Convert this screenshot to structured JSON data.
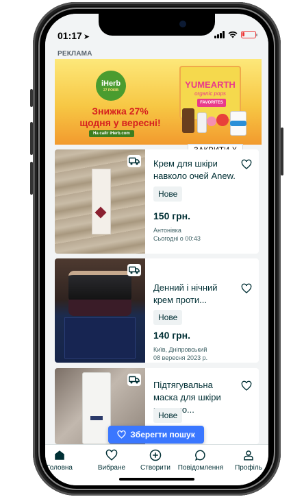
{
  "status_bar": {
    "time": "01:17"
  },
  "ad": {
    "label": "РЕКЛАМА",
    "brand": "iHerb",
    "brand_sub": "27 РОКІВ",
    "headline_line1": "Знижка 27%",
    "headline_line2": "щодня у вересні!",
    "cta": "На сайт iHerb.com",
    "product_brand": "YUMEARTH",
    "product_kind": "organic pops",
    "product_tag": "FAVORITES",
    "close_label": "ЗАКРИТИ X"
  },
  "listings": [
    {
      "title": "Крем для шкіри навколо очей Anew.",
      "condition": "Нове",
      "price": "150 грн.",
      "location": "Антонівка",
      "date": "Сьогодні о 00:43"
    },
    {
      "title": "Денний і нічний крем проти...",
      "condition": "Нове",
      "price": "140 грн.",
      "location": "Київ, Дніпровський",
      "date": "08 вересня 2023 р."
    },
    {
      "title": "Підтягувальна маска для шкіри навколо...",
      "condition": "Нове",
      "price": "",
      "location": "",
      "date": ""
    }
  ],
  "save_search": {
    "label": "Зберегти пошук"
  },
  "tabbar": {
    "items": [
      {
        "label": "Головна",
        "icon": "home-icon"
      },
      {
        "label": "Вибране",
        "icon": "heart-icon"
      },
      {
        "label": "Створити",
        "icon": "plus-circle-icon"
      },
      {
        "label": "Повідомлення",
        "icon": "chat-bubble-icon"
      },
      {
        "label": "Профіль",
        "icon": "user-icon"
      }
    ]
  },
  "colors": {
    "accent": "#3a77ff",
    "text": "#002f34",
    "iherb_green": "#4a9c2f",
    "ad_red": "#d6201f"
  }
}
